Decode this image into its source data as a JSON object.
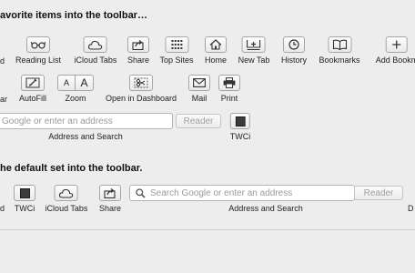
{
  "headings": {
    "drag_items": "avorite items into the toolbar…",
    "default_set": "he default set into the toolbar."
  },
  "row1": {
    "cut_left": "d",
    "items": [
      {
        "label": "Reading List",
        "icon": "glasses-icon"
      },
      {
        "label": "iCloud Tabs",
        "icon": "cloud-icon"
      },
      {
        "label": "Share",
        "icon": "share-icon"
      },
      {
        "label": "Top Sites",
        "icon": "grid-icon"
      },
      {
        "label": "Home",
        "icon": "house-icon"
      },
      {
        "label": "New Tab",
        "icon": "new-tab-icon"
      },
      {
        "label": "History",
        "icon": "clock-icon"
      },
      {
        "label": "Bookmarks",
        "icon": "book-icon"
      },
      {
        "label": "Add Bookm",
        "icon": "plus-icon"
      }
    ]
  },
  "row2": {
    "cut_left": "ar",
    "items": [
      {
        "label": "AutoFill",
        "icon": "pencil-icon"
      },
      {
        "label": "Zoom",
        "icon": "text-size-icon",
        "small_a": "A",
        "big_a": "A"
      },
      {
        "label": "Open in Dashboard",
        "icon": "scissors-icon"
      },
      {
        "label": "Mail",
        "icon": "envelope-icon"
      },
      {
        "label": "Print",
        "icon": "printer-icon"
      }
    ]
  },
  "address_row": {
    "placeholder": "Google or enter an address",
    "reader_label": "Reader",
    "caption": "Address and Search",
    "twci_label": "TWCi",
    "twci_icon": "square-icon"
  },
  "default_row": {
    "cut_left": "d",
    "items": [
      {
        "label": "TWCi",
        "icon": "square-icon"
      },
      {
        "label": "iCloud Tabs",
        "icon": "cloud-icon"
      },
      {
        "label": "Share",
        "icon": "share-icon"
      }
    ],
    "search_placeholder": "Search Google or enter an address",
    "reader_label": "Reader",
    "caption": "Address and Search",
    "cut_right": "D"
  }
}
